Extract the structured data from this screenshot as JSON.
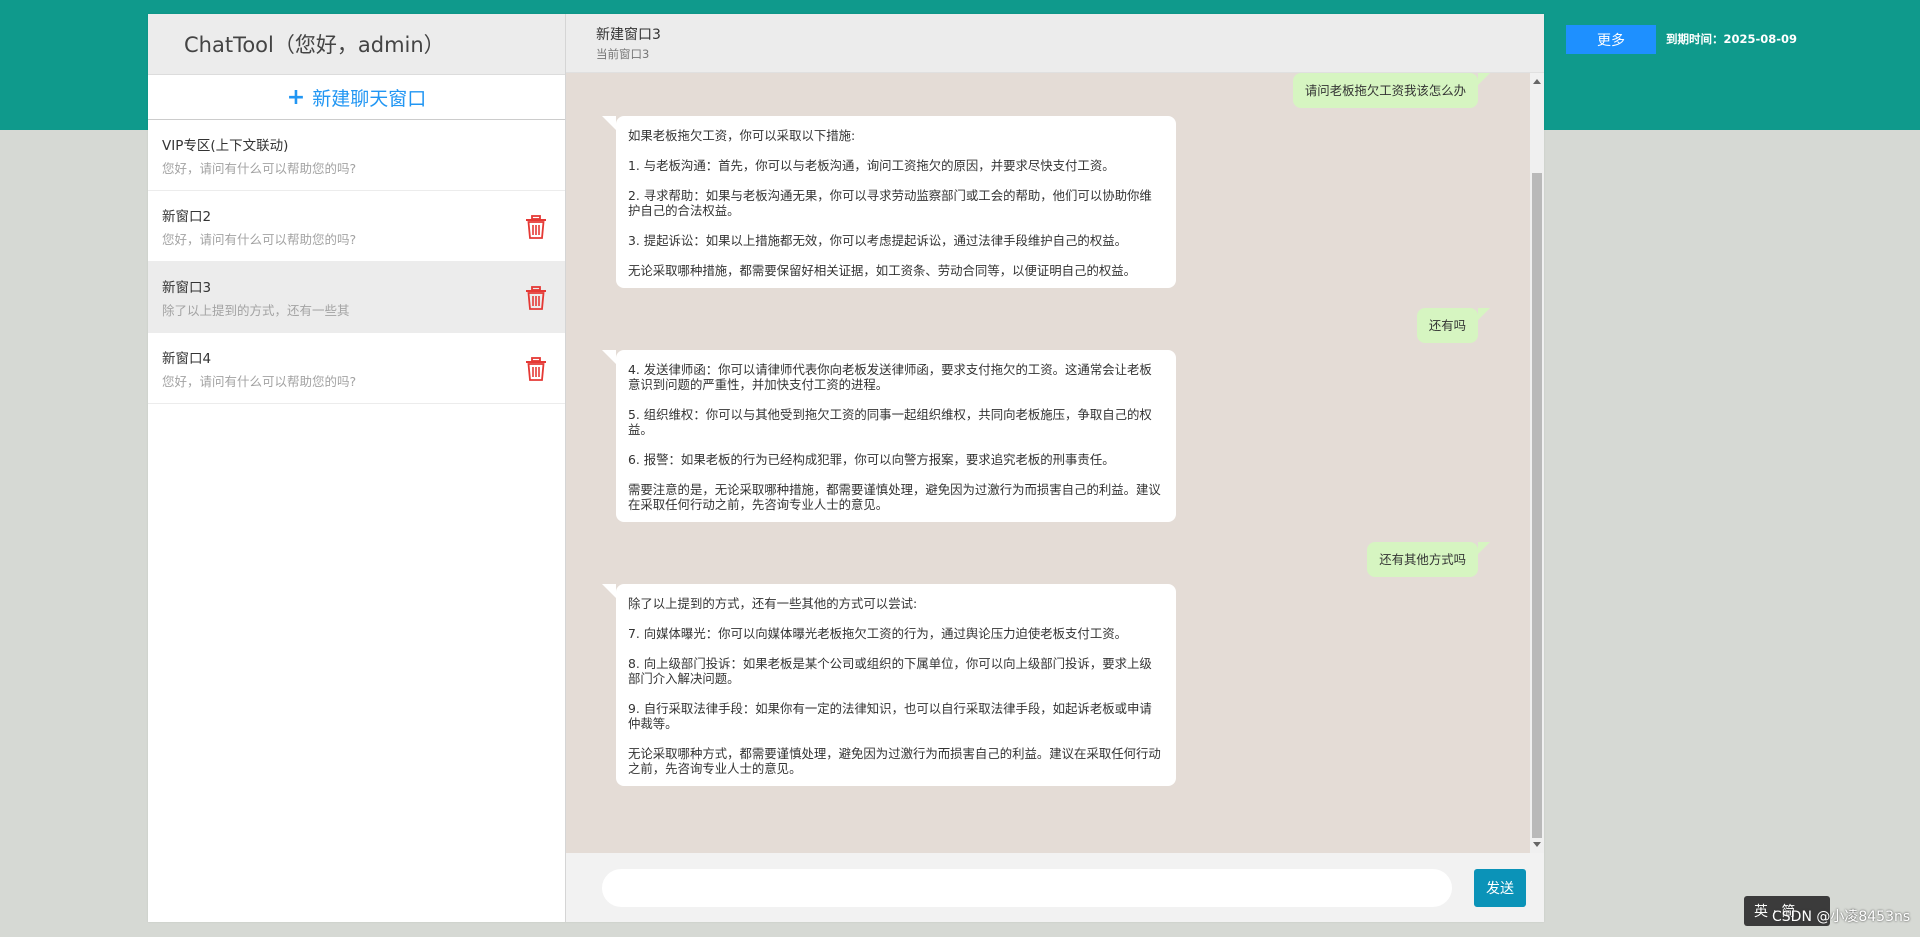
{
  "app": {
    "title": "ChatTool（您好，admin）",
    "new_chat_label": "新建聊天窗口"
  },
  "sessions": [
    {
      "title": "VIP专区(上下文联动)",
      "preview": "您好，请问有什么可以帮助您的吗?",
      "deletable": false
    },
    {
      "title": "新窗口2",
      "preview": "您好，请问有什么可以帮助您的吗?",
      "deletable": true
    },
    {
      "title": "新窗口3",
      "preview": "除了以上提到的方式，还有一些其",
      "deletable": true,
      "active": true
    },
    {
      "title": "新窗口4",
      "preview": "您好，请问有什么可以帮助您的吗?",
      "deletable": true
    }
  ],
  "chat": {
    "title": "新建窗口3",
    "subtitle": "当前窗口3"
  },
  "messages": [
    {
      "role": "user",
      "text": "请问老板拖欠工资我该怎么办"
    },
    {
      "role": "bot",
      "paragraphs": [
        "如果老板拖欠工资，你可以采取以下措施:",
        "1. 与老板沟通：首先，你可以与老板沟通，询问工资拖欠的原因，并要求尽快支付工资。",
        "2. 寻求帮助：如果与老板沟通无果，你可以寻求劳动监察部门或工会的帮助，他们可以协助你维护自己的合法权益。",
        "3. 提起诉讼：如果以上措施都无效，你可以考虑提起诉讼，通过法律手段维护自己的权益。",
        "无论采取哪种措施，都需要保留好相关证据，如工资条、劳动合同等，以便证明自己的权益。"
      ]
    },
    {
      "role": "user",
      "text": "还有吗"
    },
    {
      "role": "bot",
      "paragraphs": [
        "4. 发送律师函：你可以请律师代表你向老板发送律师函，要求支付拖欠的工资。这通常会让老板意识到问题的严重性，并加快支付工资的进程。",
        "5. 组织维权：你可以与其他受到拖欠工资的同事一起组织维权，共同向老板施压，争取自己的权益。",
        "6. 报警：如果老板的行为已经构成犯罪，你可以向警方报案，要求追究老板的刑事责任。",
        "需要注意的是，无论采取哪种措施，都需要谨慎处理，避免因为过激行为而损害自己的利益。建议在采取任何行动之前，先咨询专业人士的意见。"
      ]
    },
    {
      "role": "user",
      "text": "还有其他方式吗"
    },
    {
      "role": "bot",
      "paragraphs": [
        "除了以上提到的方式，还有一些其他的方式可以尝试:",
        "7. 向媒体曝光：你可以向媒体曝光老板拖欠工资的行为，通过舆论压力迫使老板支付工资。",
        "8. 向上级部门投诉：如果老板是某个公司或组织的下属单位，你可以向上级部门投诉，要求上级部门介入解决问题。",
        "9. 自行采取法律手段：如果你有一定的法律知识，也可以自行采取法律手段，如起诉老板或申请仲裁等。",
        "无论采取哪种方式，都需要谨慎处理，避免因为过激行为而损害自己的利益。建议在采取任何行动之前，先咨询专业人士的意见。"
      ]
    }
  ],
  "input": {
    "placeholder": "",
    "value": ""
  },
  "send_label": "发送",
  "header_right": {
    "more_label": "更多",
    "expiry_text": "到期时间：2025-08-09"
  },
  "overlay": {
    "ime_text": "英 · 简",
    "watermark_text": "CSDN @小凌8453ns"
  },
  "colors": {
    "brand": "#0f9a8c",
    "accent": "#2196f3",
    "delete": "#e53935",
    "user_bubble": "#d6f5c1"
  },
  "icons": {
    "new_chat": "plus-icon",
    "delete": "trash-icon"
  }
}
